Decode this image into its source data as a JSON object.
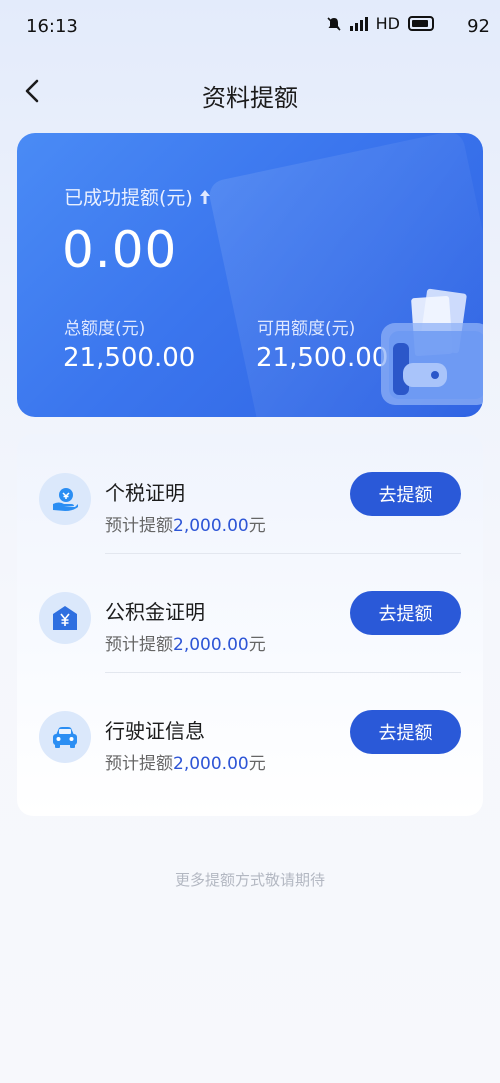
{
  "status_bar": {
    "time": "16:13",
    "network": "HD",
    "battery": "92"
  },
  "nav": {
    "title": "资料提额"
  },
  "hero": {
    "success_label": "已成功提额(元)",
    "success_amount": "0.00",
    "total_label": "总额度(元)",
    "total_value": "21,500.00",
    "available_label": "可用额度(元)",
    "available_value": "21,500.00"
  },
  "items": [
    {
      "title": "个税证明",
      "sub_prefix": "预计提额",
      "amount": "2,000.00",
      "unit": "元",
      "button": "去提额",
      "icon": "tax-icon"
    },
    {
      "title": "公积金证明",
      "sub_prefix": "预计提额",
      "amount": "2,000.00",
      "unit": "元",
      "button": "去提额",
      "icon": "housing-fund-icon"
    },
    {
      "title": "行驶证信息",
      "sub_prefix": "预计提额",
      "amount": "2,000.00",
      "unit": "元",
      "button": "去提额",
      "icon": "car-icon"
    }
  ],
  "footer": {
    "note": "更多提额方式敬请期待"
  },
  "colors": {
    "accent": "#2a59d8",
    "card_gradient_start": "#4a8bf5",
    "card_gradient_end": "#2f63e3",
    "amount_text": "#2d55d6"
  }
}
